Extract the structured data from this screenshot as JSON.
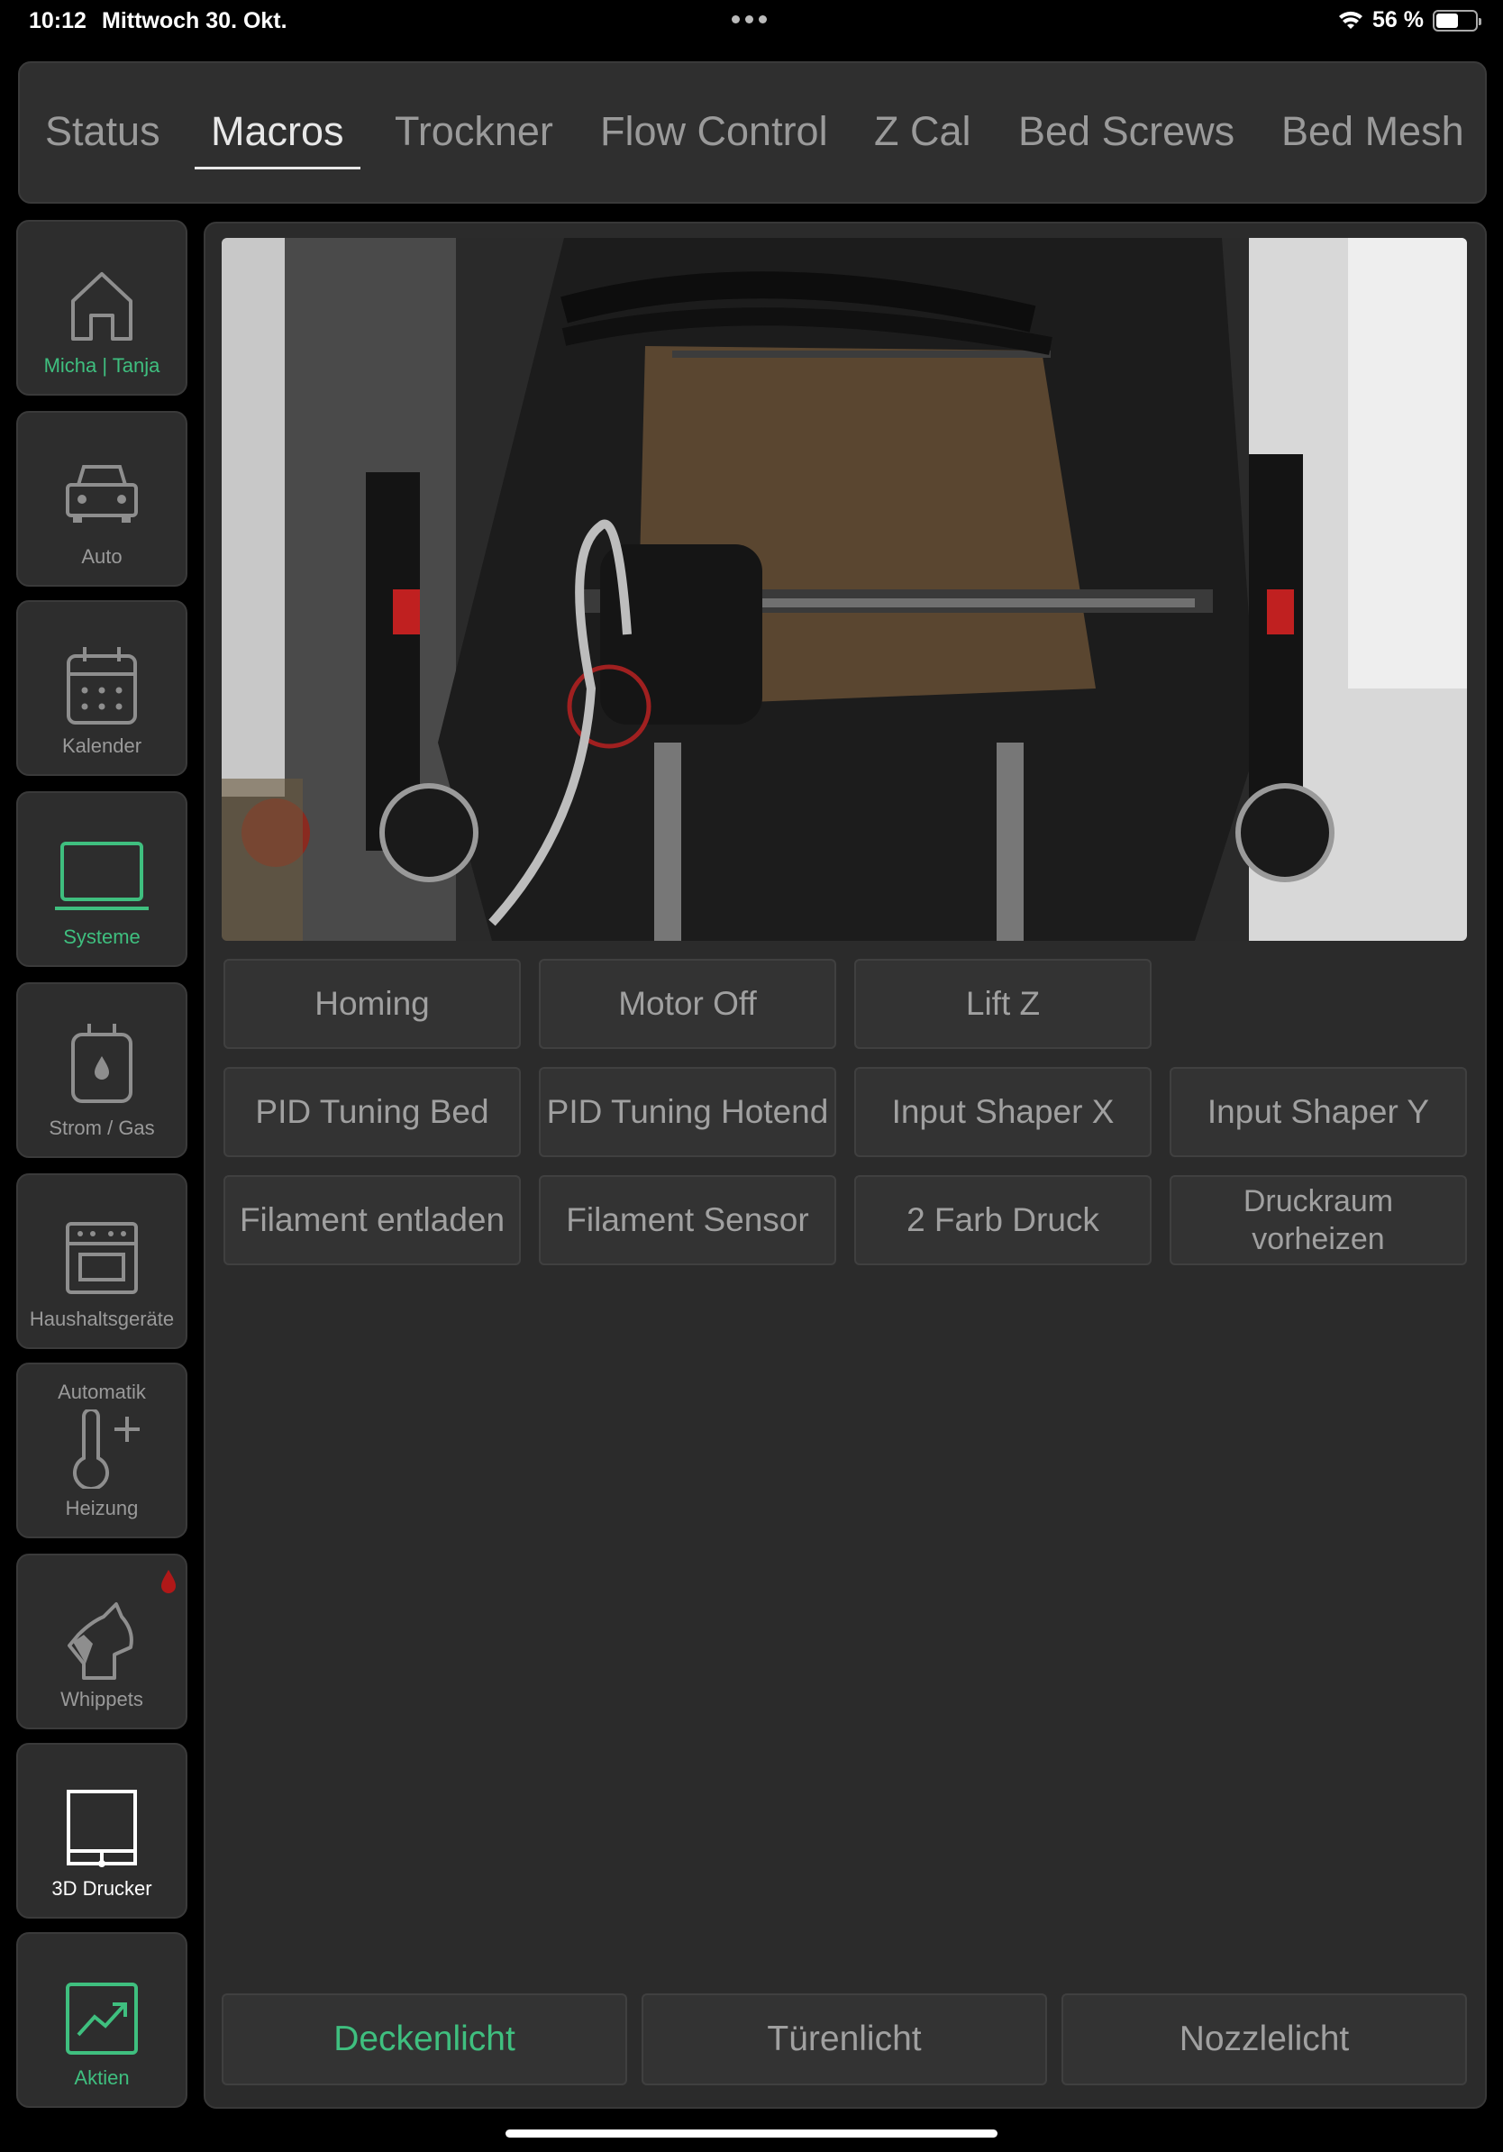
{
  "status_bar": {
    "time": "10:12",
    "date": "Mittwoch 30. Okt.",
    "battery": "56 %",
    "battery_level": 0.56
  },
  "tabs": [
    {
      "label": "Status"
    },
    {
      "label": "Macros",
      "active": true
    },
    {
      "label": "Trockner"
    },
    {
      "label": "Flow Control"
    },
    {
      "label": "Z Cal"
    },
    {
      "label": "Bed Screws"
    },
    {
      "label": "Bed Mesh"
    }
  ],
  "sidebar": {
    "items": [
      {
        "label": "Micha | Tanja",
        "icon": "home-icon",
        "color": "#3fbf7f"
      },
      {
        "label": "Auto",
        "icon": "car-icon"
      },
      {
        "label": "Kalender",
        "icon": "calendar-icon"
      },
      {
        "label": "Systeme",
        "icon": "laptop-icon",
        "color": "#3fbf7f"
      },
      {
        "label": "Strom / Gas",
        "icon": "meter-icon"
      },
      {
        "label": "Haushaltsgeräte",
        "icon": "appliance-icon"
      },
      {
        "label": "Heizung",
        "toplabel": "Automatik",
        "icon": "thermometer-plus-icon"
      },
      {
        "label": "Whippets",
        "icon": "dog-icon",
        "badge_color": "#b01818"
      },
      {
        "label": "3D Drucker",
        "icon": "printer-icon",
        "color": "#ffffff"
      },
      {
        "label": "Aktien",
        "icon": "chart-up-icon",
        "color": "#3fbf7f"
      }
    ]
  },
  "macros": {
    "row1": [
      "Homing",
      "Motor Off",
      "Lift Z"
    ],
    "row2": [
      "PID Tuning Bed",
      "PID Tuning Hotend",
      "Input Shaper X",
      "Input Shaper Y"
    ],
    "row3": [
      "Filament entladen",
      "Filament Sensor",
      "2 Farb Druck",
      "Druckraum vorheizen"
    ]
  },
  "lights": [
    {
      "label": "Deckenlicht",
      "color": "#3fbf7f"
    },
    {
      "label": "Türenlicht"
    },
    {
      "label": "Nozzlelicht"
    }
  ]
}
